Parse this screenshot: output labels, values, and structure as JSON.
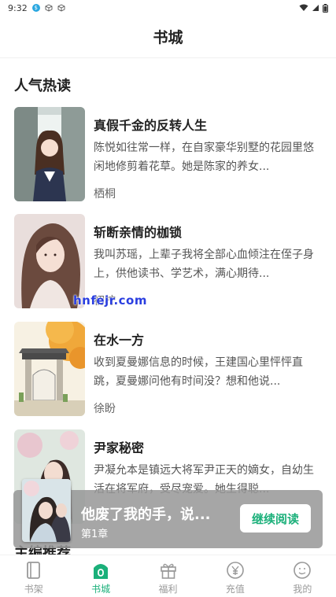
{
  "status_bar": {
    "time": "9:32"
  },
  "header": {
    "title": "书城"
  },
  "sections": {
    "popular_title": "人气热读",
    "second_title": "主编推荐"
  },
  "books": [
    {
      "title": "真假千金的反转人生",
      "desc": "陈悦如往常一样，在自家豪华别墅的花园里悠闲地修剪着花草。她是陈家的养女...",
      "author": "栖桐"
    },
    {
      "title": "斩断亲情的枷锁",
      "desc": "我叫苏瑶，上辈子我将全部心血倾注在侄子身上，供他读书、学艺术，满心期待...",
      "author": "初柠"
    },
    {
      "title": "在水一方",
      "desc": "收到夏曼娜信息的时候，王建国心里怦怦直跳，夏曼娜问他有时间没？想和他说...",
      "author": "徐盼"
    },
    {
      "title": "尹家秘密",
      "desc": "尹凝允本是镇远大将军尹正天的嫡女，自幼生活在将军府，受尽宠爱。她生得聪...",
      "author": ""
    }
  ],
  "watermark": "hnfejr.com",
  "continue_reading": {
    "title": "他废了我的手，说...",
    "chapter": "第1章",
    "button": "继续阅读"
  },
  "nav": [
    {
      "label": "书架",
      "icon": "bookshelf-icon"
    },
    {
      "label": "书城",
      "icon": "bookstore-icon"
    },
    {
      "label": "福利",
      "icon": "gift-icon"
    },
    {
      "label": "充值",
      "icon": "yen-icon"
    },
    {
      "label": "我的",
      "icon": "profile-icon"
    }
  ],
  "colors": {
    "accent": "#1bb07a",
    "inactive": "#999999"
  }
}
